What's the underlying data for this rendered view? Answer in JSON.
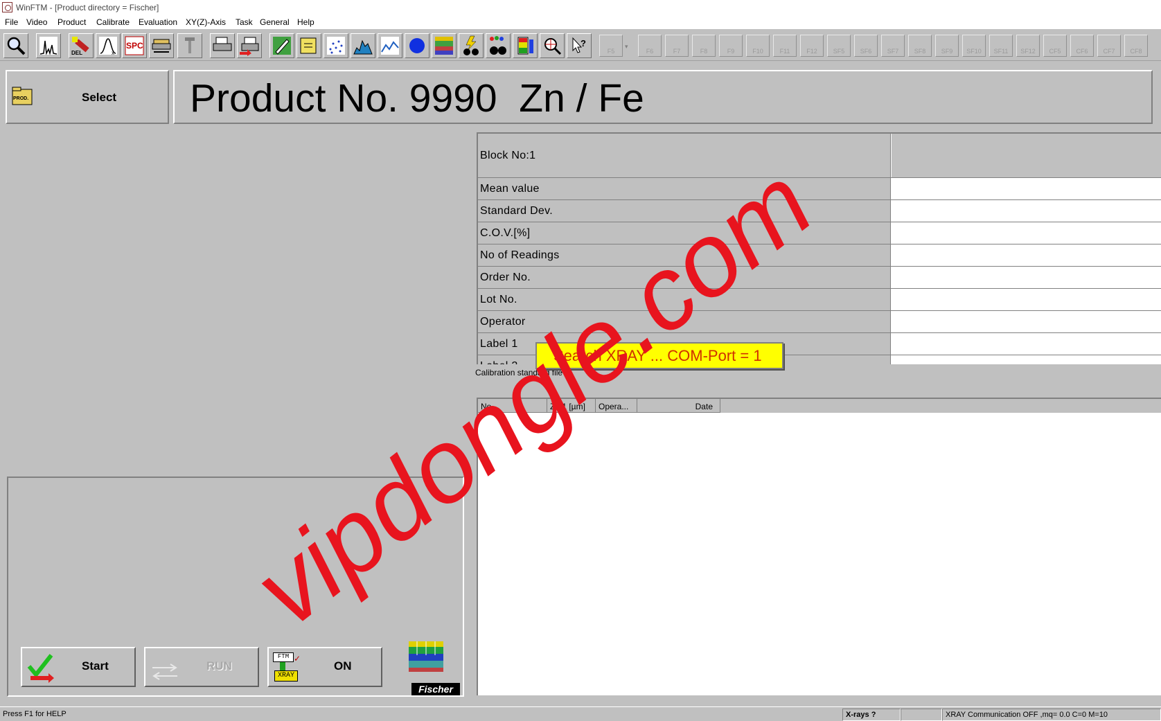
{
  "window": {
    "title": "WinFTM - [Product directory = Fischer]"
  },
  "menu": [
    "File",
    "Video",
    "Product",
    "Calibrate",
    "Evaluation",
    "XY(Z)-Axis",
    "Task",
    "General",
    "Help"
  ],
  "function_keys": [
    "F5",
    "F6",
    "F7",
    "F8",
    "F9",
    "F10",
    "F11",
    "F12",
    "SF5",
    "SF6",
    "SF7",
    "SF8",
    "SF9",
    "SF10",
    "SF11",
    "SF12",
    "CF5",
    "CF6",
    "CF7",
    "CF8"
  ],
  "product": {
    "select_label": "Select",
    "prod_icon_text": "PROD.",
    "title": "Product No. 9990  Zn / Fe"
  },
  "stats": {
    "block": "Block No:1",
    "rows": [
      "Mean value",
      "Standard Dev.",
      "C.O.V.[%]",
      "No of Readings",
      "Order No.",
      "Lot No.",
      "Operator",
      "Label 1",
      "Label 2"
    ]
  },
  "calibration": {
    "label": "Calibration standard file",
    "columns": [
      "No",
      "Zn 1 [µm]",
      "Opera...",
      "Date"
    ]
  },
  "popup": {
    "text": "Search XRAY ... COM-Port = 1"
  },
  "controls": {
    "start": "Start",
    "run": "RUN",
    "on": "ON",
    "xray_badge_top": "FTM",
    "xray_badge_bottom": "XRAY",
    "brand": "Fischer"
  },
  "statusbar": {
    "help": "Press F1 for HELP",
    "xrays": "X-rays ?",
    "comm": "XRAY Communication OFF ,mq= 0.0  C=0  M=10"
  },
  "watermark": "vipdongle.com",
  "colors": {
    "background": "#c0c0c0",
    "popup_bg": "#ffff00",
    "popup_text": "#d03000",
    "watermark": "#e8141e"
  }
}
